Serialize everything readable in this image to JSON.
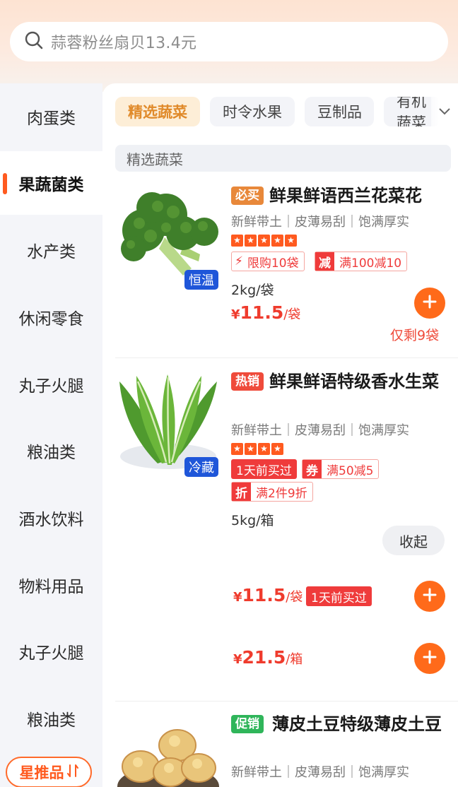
{
  "search": {
    "placeholder": "蒜蓉粉丝扇贝13.4元"
  },
  "sidebar": {
    "items": [
      {
        "label": "肉蛋类"
      },
      {
        "label": "果蔬菌类"
      },
      {
        "label": "水产类"
      },
      {
        "label": "休闲零食"
      },
      {
        "label": "丸子火腿"
      },
      {
        "label": "粮油类"
      },
      {
        "label": "酒水饮料"
      },
      {
        "label": "物料用品"
      },
      {
        "label": "丸子火腿"
      },
      {
        "label": "粮油类"
      }
    ],
    "active_index": 1,
    "star_button": "星推品"
  },
  "chips": [
    {
      "label": "精选蔬菜",
      "active": true
    },
    {
      "label": "时令水果"
    },
    {
      "label": "豆制品"
    },
    {
      "label": "有机蔬菜"
    }
  ],
  "section": {
    "title": "精选蔬菜"
  },
  "products": [
    {
      "tag": "必买",
      "tag_color": "#e8883a",
      "title": "鲜果鲜语西兰花菜花",
      "subtitle": "新鲜带土｜皮薄易刮｜饱满厚实",
      "stars": 5,
      "storage": "恒温",
      "promos": [
        {
          "lead": "⚡",
          "text": "限购10袋"
        },
        {
          "lead": "减",
          "text": "满100减10"
        }
      ],
      "spec": "2kg/袋",
      "price": {
        "currency": "¥",
        "value": "11.5",
        "unit": "/袋"
      },
      "remain": "仅剩9袋"
    },
    {
      "tag": "热销",
      "tag_color": "#ef4b3b",
      "title": "鲜果鲜语特级香水生菜",
      "subtitle": "新鲜带土｜皮薄易刮｜饱满厚实",
      "stars": 4,
      "storage": "冷藏",
      "badges": [
        "1天前买过"
      ],
      "promos": [
        {
          "lead": "券",
          "text": "满50减5"
        },
        {
          "lead": "折",
          "text": "满2件9折"
        }
      ],
      "spec": "5kg/箱",
      "collapse_label": "收起",
      "variants": [
        {
          "currency": "¥",
          "value": "11.5",
          "unit": "/袋",
          "badge": "1天前买过"
        },
        {
          "currency": "¥",
          "value": "21.5",
          "unit": "/箱"
        }
      ]
    },
    {
      "tag": "促销",
      "tag_color": "#2fb55a",
      "title": "薄皮土豆特级薄皮土豆",
      "subtitle": "新鲜带土｜皮薄易刮｜饱满厚实"
    }
  ],
  "colors": {
    "accent": "#ff6a1a",
    "price": "#ef3b2d",
    "badge_blue": "#1f56d9"
  }
}
